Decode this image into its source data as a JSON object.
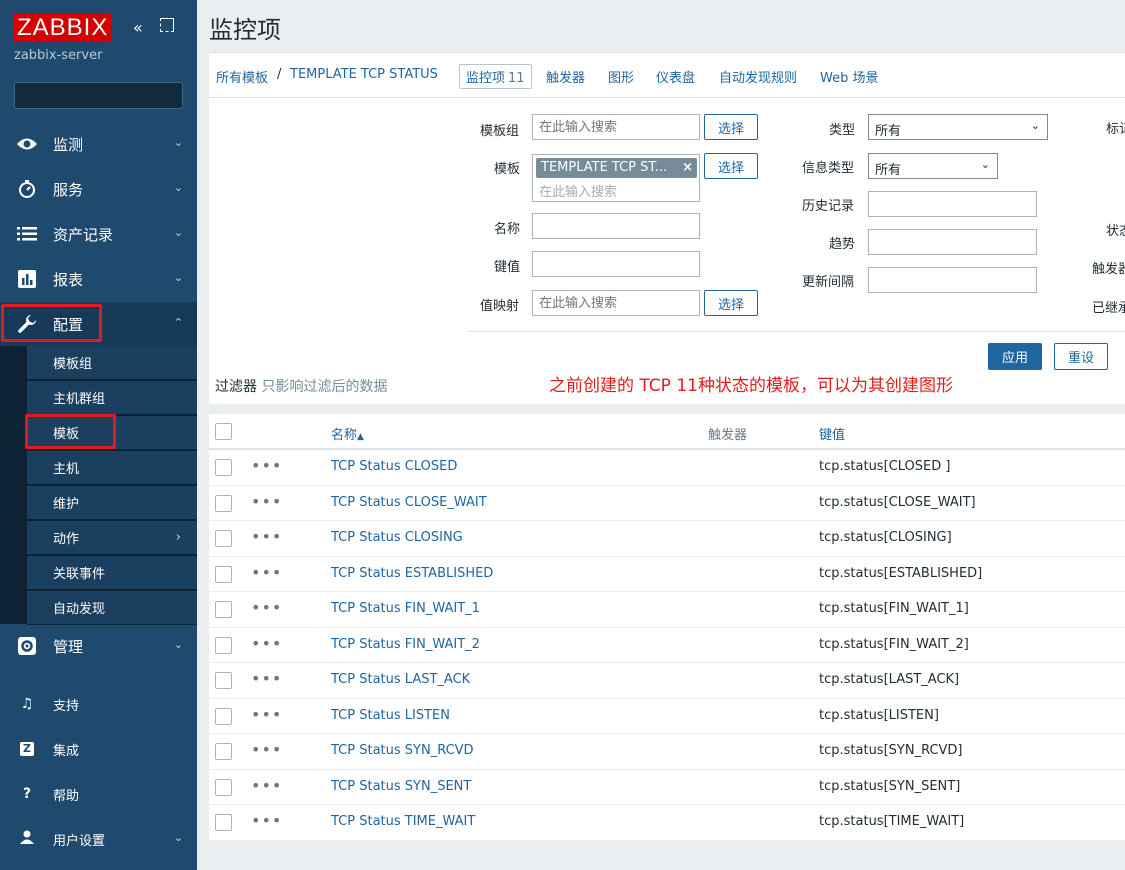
{
  "sidebar": {
    "logo": "ZABBIX",
    "server_name": "zabbix-server",
    "collapse_glyph": "«",
    "search_value": "",
    "menu": [
      {
        "label": "监测",
        "icon": "eye-icon"
      },
      {
        "label": "服务",
        "icon": "clock-icon"
      },
      {
        "label": "资产记录",
        "icon": "list-icon"
      },
      {
        "label": "报表",
        "icon": "bar-chart-icon"
      },
      {
        "label": "配置",
        "icon": "wrench-icon"
      }
    ],
    "submenu": [
      "模板组",
      "主机群组",
      "模板",
      "主机",
      "维护",
      "动作",
      "关联事件",
      "自动发现"
    ],
    "admin": {
      "label": "管理",
      "icon": "gear-icon"
    },
    "bottom": [
      {
        "label": "支持",
        "icon": "headset-icon",
        "glyph": "♫"
      },
      {
        "label": "集成",
        "icon": "zabbix-icon",
        "glyph": "Z"
      },
      {
        "label": "帮助",
        "icon": "help-icon",
        "glyph": "?"
      },
      {
        "label": "用户设置",
        "icon": "user-icon",
        "glyph": "●"
      }
    ]
  },
  "header": {
    "title": "监控项"
  },
  "breadcrumbs": {
    "all_templates": "所有模板",
    "separator": "/",
    "template": "TEMPLATE TCP STATUS",
    "items": "监控项",
    "items_count": "11",
    "triggers": "触发器",
    "graphs": "图形",
    "dashboards": "仪表盘",
    "discovery": "自动发现规则",
    "web": "Web 场景"
  },
  "filter": {
    "template_group_label": "模板组",
    "template_label": "模板",
    "name_label": "名称",
    "key_label": "键值",
    "valuemap_label": "值映射",
    "placeholder": "在此输入搜索",
    "select_label": "选择",
    "template_tag": "TEMPLATE TCP ST...",
    "tag_remove": "×",
    "type_label": "类型",
    "type_value": "所有",
    "info_type_label": "信息类型",
    "info_type_value": "所有",
    "history_label": "历史记录",
    "trends_label": "趋势",
    "interval_label": "更新间隔",
    "right_labels": [
      "标记",
      "状态",
      "触发器",
      "已继承"
    ],
    "apply_label": "应用",
    "reset_label": "重设",
    "caption": "过滤器",
    "caption_note": "只影响过滤后的数据"
  },
  "annotation": "之前创建的 TCP 11种状态的模板，可以为其创建图形",
  "table": {
    "col_name": "名称",
    "sort_arrow": "▲",
    "col_triggers": "触发器",
    "col_key": "键值",
    "row_menu_glyph": "•••",
    "rows": [
      {
        "name": "TCP Status CLOSED",
        "key": "tcp.status[CLOSED ]"
      },
      {
        "name": "TCP Status CLOSE_WAIT",
        "key": "tcp.status[CLOSE_WAIT]"
      },
      {
        "name": "TCP Status CLOSING",
        "key": "tcp.status[CLOSING]"
      },
      {
        "name": "TCP Status ESTABLISHED",
        "key": "tcp.status[ESTABLISHED]"
      },
      {
        "name": "TCP Status FIN_WAIT_1",
        "key": "tcp.status[FIN_WAIT_1]"
      },
      {
        "name": "TCP Status FIN_WAIT_2",
        "key": "tcp.status[FIN_WAIT_2]"
      },
      {
        "name": "TCP Status LAST_ACK",
        "key": "tcp.status[LAST_ACK]"
      },
      {
        "name": "TCP Status LISTEN",
        "key": "tcp.status[LISTEN]"
      },
      {
        "name": "TCP Status SYN_RCVD",
        "key": "tcp.status[SYN_RCVD]"
      },
      {
        "name": "TCP Status SYN_SENT",
        "key": "tcp.status[SYN_SENT]"
      },
      {
        "name": "TCP Status TIME_WAIT",
        "key": "tcp.status[TIME_WAIT]"
      }
    ]
  },
  "colors": {
    "brand": "#d40000",
    "sidebar": "#1f4a6e",
    "link": "#1f65a0",
    "highlight": "#e31b1b"
  }
}
